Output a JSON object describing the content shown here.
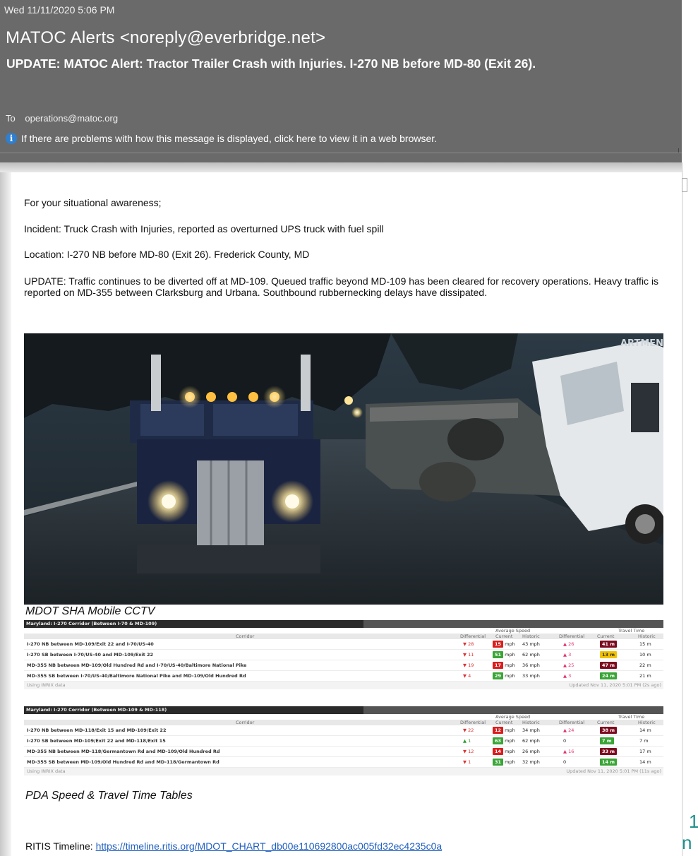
{
  "header": {
    "date": "Wed 11/11/2020 5:06 PM",
    "sender": "MATOC Alerts <noreply@everbridge.net>",
    "subject": "UPDATE: MATOC Alert: Tractor Trailer Crash with Injuries. I-270 NB before MD-80 (Exit 26).",
    "to_label": "To",
    "to_value": "operations@matoc.org",
    "info_text": "If there are problems with how this message is displayed, click here to view it in a web browser."
  },
  "body": {
    "p1": "For your situational awareness;",
    "p2": "Incident: Truck Crash with Injuries, reported as overturned UPS truck with fuel spill",
    "p3": "Location: I-270 NB before MD-80 (Exit 26). Frederick County, MD",
    "p4": "UPDATE: Traffic continues to be diverted off at MD-109. Queued traffic beyond MD-109 has been cleared for recovery operations. Heavy traffic is reported on MD-355 between Clarksburg and Urbana. Southbound rubbernecking delays have dissipated.",
    "photo_text": "ARTMENT RTATION",
    "photo_caption": "MDOT SHA Mobile CCTV",
    "tables_caption": "PDA Speed & Travel Time Tables",
    "ritis_label": "RITIS Timeline: ",
    "ritis_link": "https://timeline.ritis.org/MDOT_CHART_db00e110692800ac005fd32ec4235c0a"
  },
  "table_headers": {
    "corridor": "Corridor",
    "avg_speed": "Average Speed",
    "travel_time": "Travel Time",
    "differential": "Differential",
    "current": "Current",
    "historic": "Historic"
  },
  "table1": {
    "title": "Maryland: I-270 Corridor (Between I-70 & MD-109)",
    "foot_left": "Using INRIX data",
    "foot_right": "Updated Nov 11, 2020 5:01 PM (2s ago)",
    "rows": [
      {
        "name": "I-270 NB between MD-109/Exit 22 and I-70/US-40",
        "sd": "28",
        "sc": "15",
        "sh": "43 mph",
        "td": "26",
        "tc": "41 m",
        "th": "15 m",
        "sdir": "down",
        "tdir": "up",
        "scol": "red",
        "tcol": "dred"
      },
      {
        "name": "I-270 SB between I-70/US-40 and MD-109/Exit 22",
        "sd": "11",
        "sc": "51",
        "sh": "62 mph",
        "td": "3",
        "tc": "13 m",
        "th": "10 m",
        "sdir": "down",
        "tdir": "up",
        "scol": "grn",
        "tcol": "yel"
      },
      {
        "name": "MD-355 NB between MD-109/Old Hundred Rd and I-70/US-40/Baltimore National Pike",
        "sd": "19",
        "sc": "17",
        "sh": "36 mph",
        "td": "25",
        "tc": "47 m",
        "th": "22 m",
        "sdir": "down",
        "tdir": "up",
        "scol": "red",
        "tcol": "dred"
      },
      {
        "name": "MD-355 SB between I-70/US-40/Baltimore National Pike and MD-109/Old Hundred Rd",
        "sd": "4",
        "sc": "29",
        "sh": "33 mph",
        "td": "3",
        "tc": "24 m",
        "th": "21 m",
        "sdir": "down",
        "tdir": "up",
        "scol": "grn",
        "tcol": "grn"
      }
    ]
  },
  "table2": {
    "title": "Maryland: I-270 Corridor (Between MD-109 & MD-118)",
    "foot_left": "Using INRIX data",
    "foot_right": "Updated Nov 11, 2020 5:01 PM (11s ago)",
    "rows": [
      {
        "name": "I-270 NB between MD-118/Exit 15 and MD-109/Exit 22",
        "sd": "22",
        "sc": "12",
        "sh": "34 mph",
        "td": "24",
        "tc": "38 m",
        "th": "14 m",
        "sdir": "down",
        "tdir": "up",
        "scol": "red",
        "tcol": "dred"
      },
      {
        "name": "I-270 SB between MD-109/Exit 22 and MD-118/Exit 15",
        "sd": "1",
        "sc": "63",
        "sh": "62 mph",
        "td": "0",
        "tc": "7 m",
        "th": "7 m",
        "sdir": "upg",
        "tdir": "none",
        "scol": "grn",
        "tcol": "grn"
      },
      {
        "name": "MD-355 NB between MD-118/Germantown Rd and MD-109/Old Hundred Rd",
        "sd": "12",
        "sc": "14",
        "sh": "26 mph",
        "td": "16",
        "tc": "33 m",
        "th": "17 m",
        "sdir": "down",
        "tdir": "up",
        "scol": "red",
        "tcol": "dred"
      },
      {
        "name": "MD-355 SB between MD-109/Old Hundred Rd and MD-118/Germantown Rd",
        "sd": "1",
        "sc": "31",
        "sh": "32 mph",
        "td": "0",
        "tc": "14 m",
        "th": "14 m",
        "sdir": "down",
        "tdir": "none",
        "scol": "grn",
        "tcol": "grn"
      }
    ]
  },
  "units": {
    "mph": "mph"
  },
  "side": {
    "p1": "1",
    "p2": "n"
  },
  "colors": {
    "header_bg": "#6a6a6a",
    "link": "#1f5fbf",
    "page_accent": "#1e8f8f"
  }
}
